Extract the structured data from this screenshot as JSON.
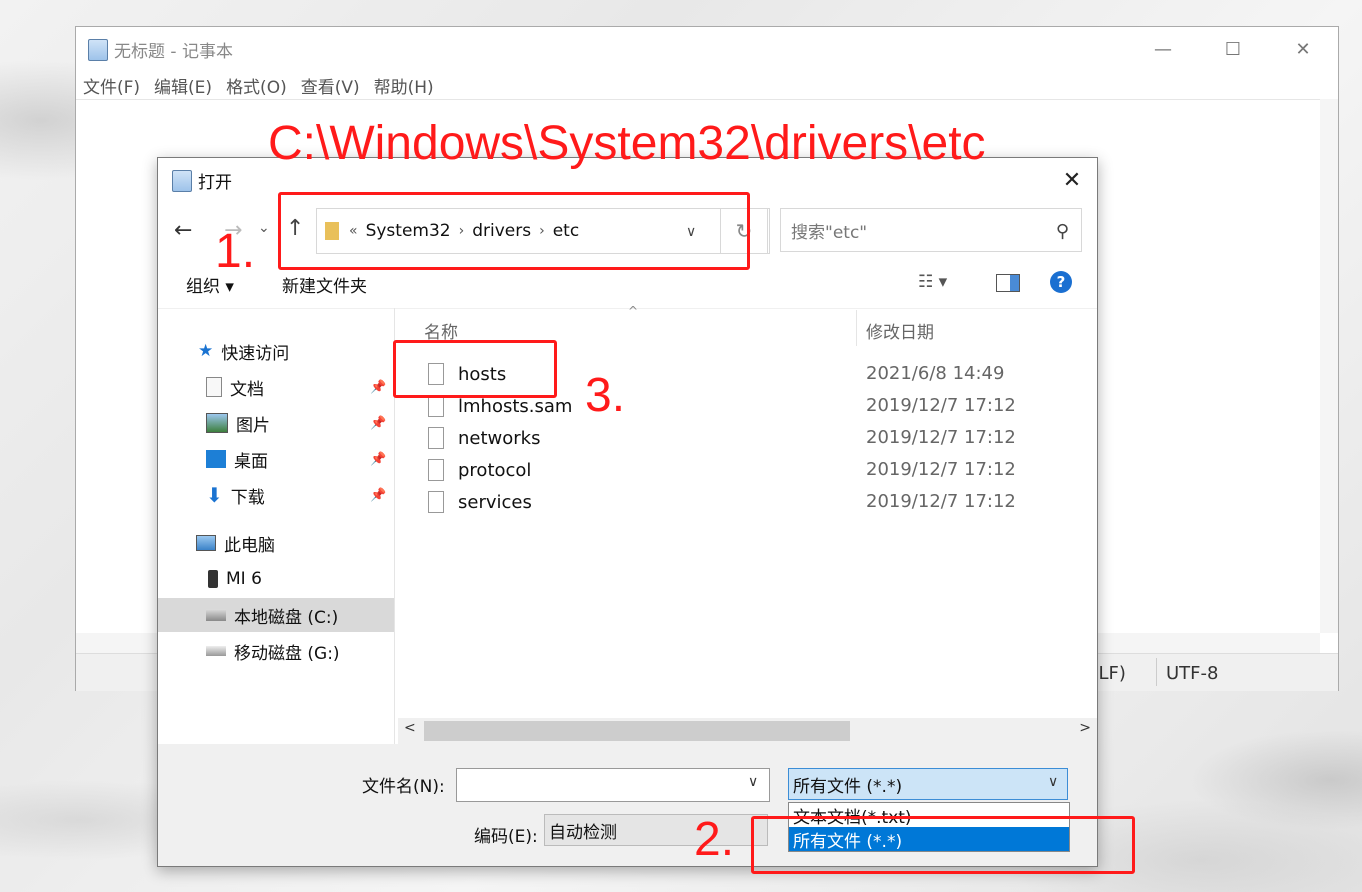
{
  "notepad": {
    "title": "无标题 - 记事本",
    "menu": [
      "文件(F)",
      "编辑(E)",
      "格式(O)",
      "查看(V)",
      "帮助(H)"
    ],
    "status_line_ending": "RLF)",
    "status_encoding": "UTF-8"
  },
  "annotations": {
    "path": "C:\\Windows\\System32\\drivers\\etc",
    "step1": "1.",
    "step2": "2.",
    "step3": "3."
  },
  "dialog": {
    "title": "打开",
    "address": {
      "overflow": "«",
      "crumbs": [
        "System32",
        "drivers",
        "etc"
      ]
    },
    "search_placeholder": "搜索\"etc\"",
    "toolbar": {
      "organize": "组织 ▾",
      "new_folder": "新建文件夹"
    },
    "sidebar": {
      "quick_access": "快速访问",
      "documents": "文档",
      "pictures": "图片",
      "desktop": "桌面",
      "downloads": "下载",
      "this_pc": "此电脑",
      "mi6": "MI 6",
      "local_disk": "本地磁盘 (C:)",
      "removable": "移动磁盘 (G:)"
    },
    "columns": {
      "name": "名称",
      "date": "修改日期"
    },
    "files": [
      {
        "name": "hosts",
        "date": "2021/6/8 14:49"
      },
      {
        "name": "lmhosts.sam",
        "date": "2019/12/7 17:12"
      },
      {
        "name": "networks",
        "date": "2019/12/7 17:12"
      },
      {
        "name": "protocol",
        "date": "2019/12/7 17:12"
      },
      {
        "name": "services",
        "date": "2019/12/7 17:12"
      }
    ],
    "filename_label": "文件名(N):",
    "filename_value": "",
    "filetype_selected": "所有文件  (*.*)",
    "filetype_options": [
      "文本文档(*.txt)",
      "所有文件  (*.*)"
    ],
    "encoding_label": "编码(E):",
    "encoding_value": "自动检测"
  }
}
